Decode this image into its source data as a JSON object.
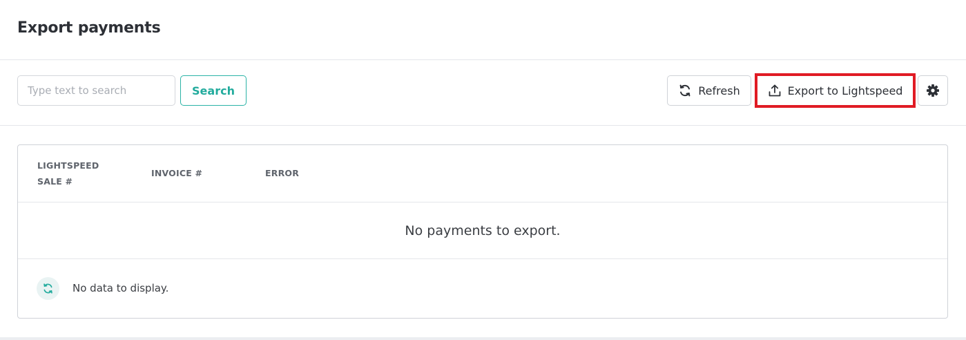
{
  "header": {
    "title": "Export payments"
  },
  "toolbar": {
    "search_placeholder": "Type text to search",
    "search_value": "",
    "search_label": "Search",
    "refresh_label": "Refresh",
    "export_label": "Export to Lightspeed",
    "refresh_icon": "refresh-icon",
    "export_icon": "upload-icon",
    "settings_icon": "gear-icon"
  },
  "table": {
    "columns": [
      "LIGHTSPEED SALE #",
      "INVOICE #",
      "ERROR"
    ],
    "empty_message": "No payments to export.",
    "footer_message": "No data to display.",
    "footer_icon": "refresh-icon"
  },
  "colors": {
    "accent": "#22ab9d",
    "highlight": "#e01b24",
    "text": "#2d3036"
  }
}
